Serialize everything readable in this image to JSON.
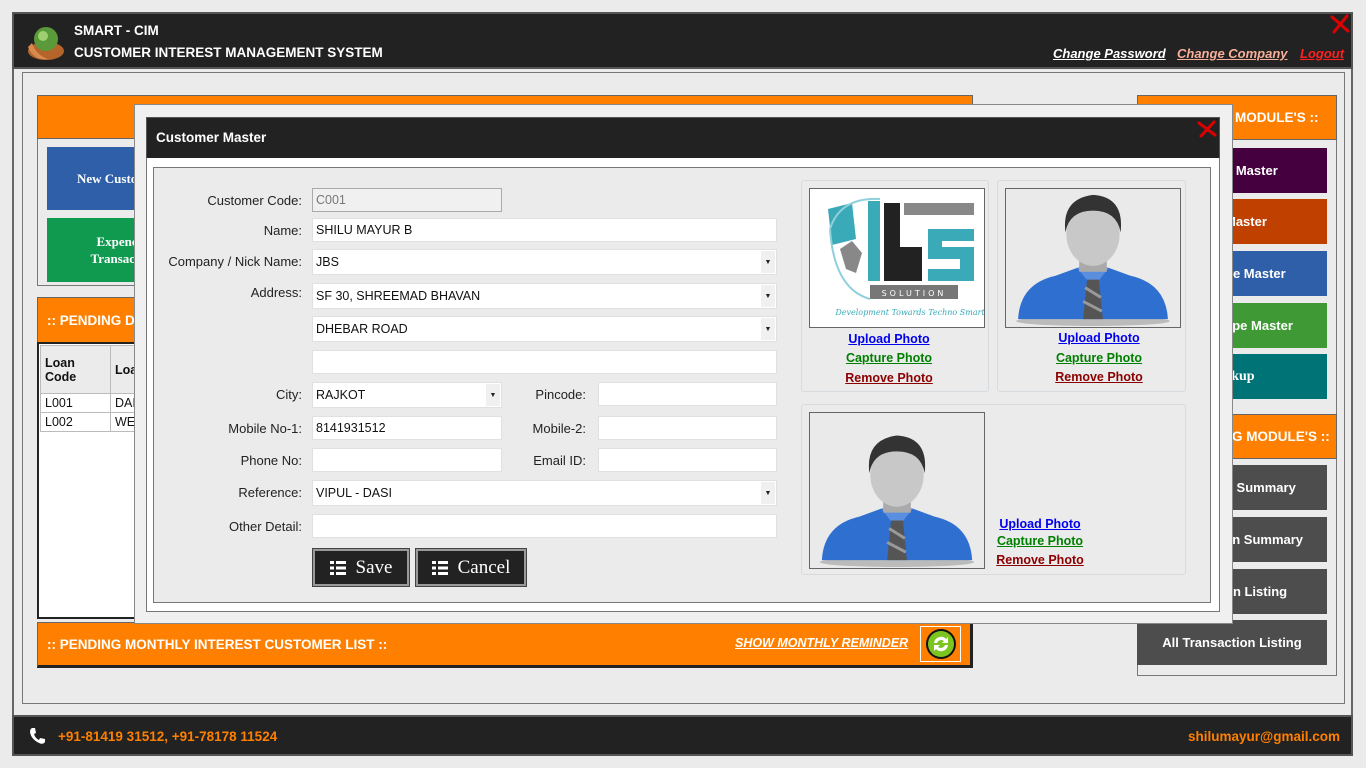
{
  "header": {
    "app_name": "SMART - CIM",
    "subtitle": "CUSTOMER INTEREST MANAGEMENT SYSTEM",
    "links": {
      "change_password": "Change Password",
      "change_company": "Change Company",
      "logout": "Logout"
    }
  },
  "dashboard": {
    "tiles": {
      "new_customer": "New Custome",
      "expence_transaction": "Expence Transactio"
    },
    "pending_panel": {
      "title": ":: PENDING D",
      "columns": [
        "Loan Code",
        "Loa"
      ],
      "rows": [
        [
          "L001",
          "DAI"
        ],
        [
          "L002",
          "WE"
        ]
      ]
    },
    "monthly_bar": {
      "title": ":: PENDING MONTHLY INTEREST CUSTOMER LIST ::",
      "reminder_link": "SHOW MONTHLY REMINDER"
    },
    "master_modules": {
      "title": "MODULE'S ::",
      "items": [
        "y Master",
        " Master",
        "pe Master",
        "ype Master",
        "ckup"
      ]
    },
    "report_modules": {
      "title": "G MODULE'S ::",
      "items": [
        "n Summary",
        "an Summary",
        "on Listing",
        "All Transaction Listing"
      ]
    }
  },
  "modal": {
    "title": "Customer Master",
    "fields": {
      "customer_code": {
        "label": "Customer Code:",
        "value": "C001"
      },
      "name": {
        "label": "Name:",
        "value": "SHILU MAYUR B"
      },
      "company": {
        "label": "Company / Nick Name:",
        "value": "JBS"
      },
      "address": {
        "label": "Address:",
        "line1": "SF 30, SHREEMAD BHAVAN",
        "line2": "DHEBAR ROAD",
        "line3": ""
      },
      "city": {
        "label": "City:",
        "value": "RAJKOT"
      },
      "pincode": {
        "label": "Pincode:",
        "value": ""
      },
      "mobile1": {
        "label": "Mobile No-1:",
        "value": "8141931512"
      },
      "mobile2": {
        "label": "Mobile-2:",
        "value": ""
      },
      "phone": {
        "label": "Phone No:",
        "value": ""
      },
      "email": {
        "label": "Email ID:",
        "value": ""
      },
      "reference": {
        "label": "Reference:",
        "value": "VIPUL - DASI"
      },
      "other": {
        "label": "Other Detail:",
        "value": ""
      }
    },
    "buttons": {
      "save": "Save",
      "cancel": "Cancel"
    },
    "photo_links": {
      "upload": "Upload Photo",
      "capture": "Capture Photo",
      "remove": "Remove Photo"
    },
    "logo_text": {
      "brand": "JBS",
      "tag": "SOLUTION",
      "slogan": "Development Towards Techno Smart"
    }
  },
  "footer": {
    "phone": "+91-81419 31512, +91-78178 11524",
    "email": "shilumayur@gmail.com"
  },
  "colors": {
    "orange": "#ff8000",
    "dark": "#222222",
    "link_upload": "#0000ee",
    "link_capture": "#008000",
    "link_remove": "#8b0000"
  }
}
